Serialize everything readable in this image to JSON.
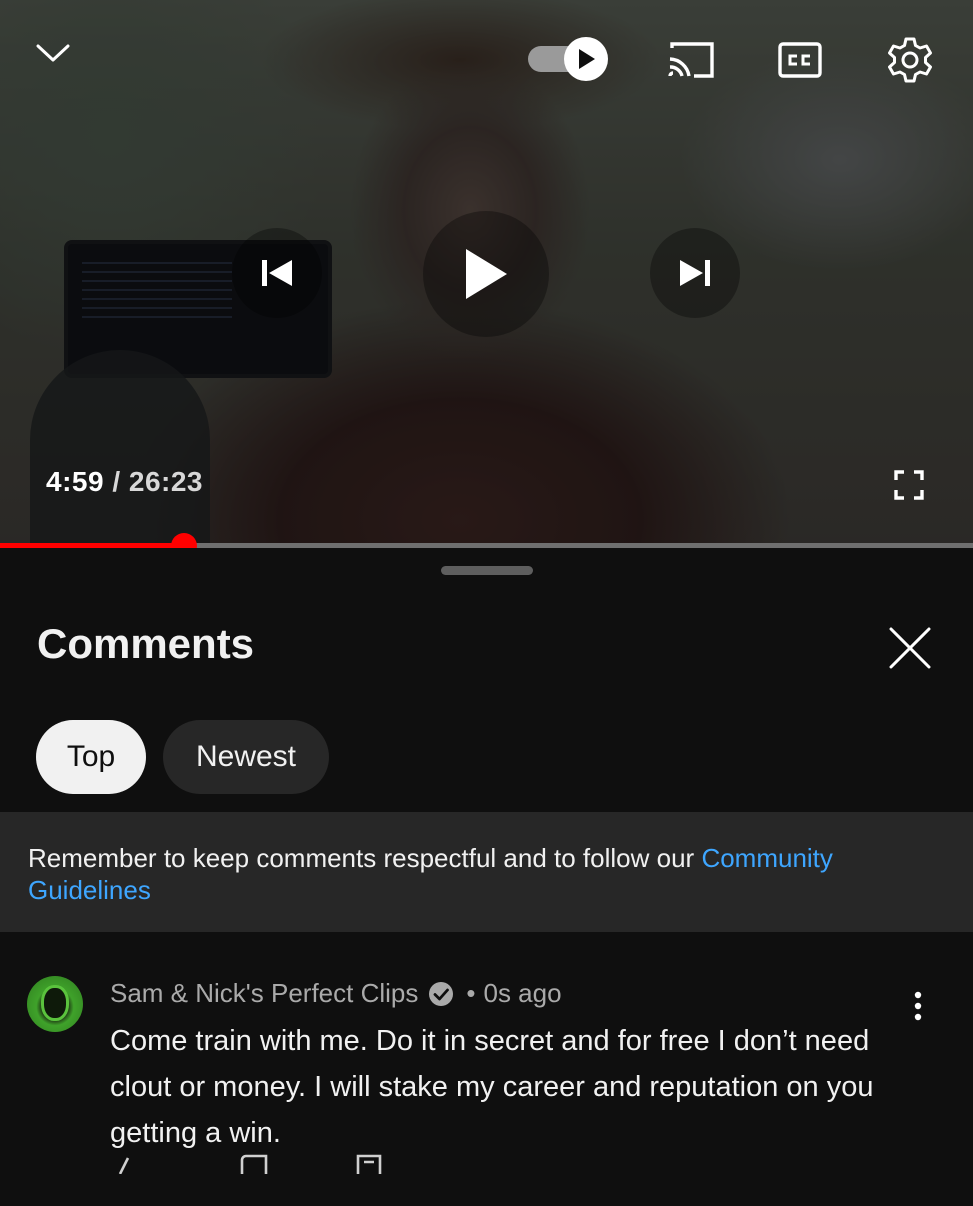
{
  "player": {
    "current_time": "4:59",
    "separator": "/",
    "total_time": "26:23",
    "progress_fraction": 0.189,
    "autoplay_on": true,
    "accent_color": "#ff0000",
    "icons": [
      "chevron-down-icon",
      "autoplay-toggle",
      "cast-icon",
      "closed-captions-icon",
      "settings-gear-icon",
      "previous-icon",
      "play-icon",
      "next-icon",
      "fullscreen-icon"
    ]
  },
  "comments_panel": {
    "title": "Comments",
    "sort_chips": [
      {
        "label": "Top",
        "selected": true
      },
      {
        "label": "Newest",
        "selected": false
      }
    ],
    "notice": {
      "text": "Remember to keep comments respectful and to follow our ",
      "link_text": "Community Guidelines",
      "link_color": "#3ea6ff"
    },
    "comments": [
      {
        "author": "Sam & Nick's Perfect Clips",
        "verified": true,
        "separator": "•",
        "time": "0s ago",
        "text": "Come train with me. Do it in secret and for free I don’t need clout or money. I will stake my career and reputation on you getting a win."
      }
    ]
  }
}
